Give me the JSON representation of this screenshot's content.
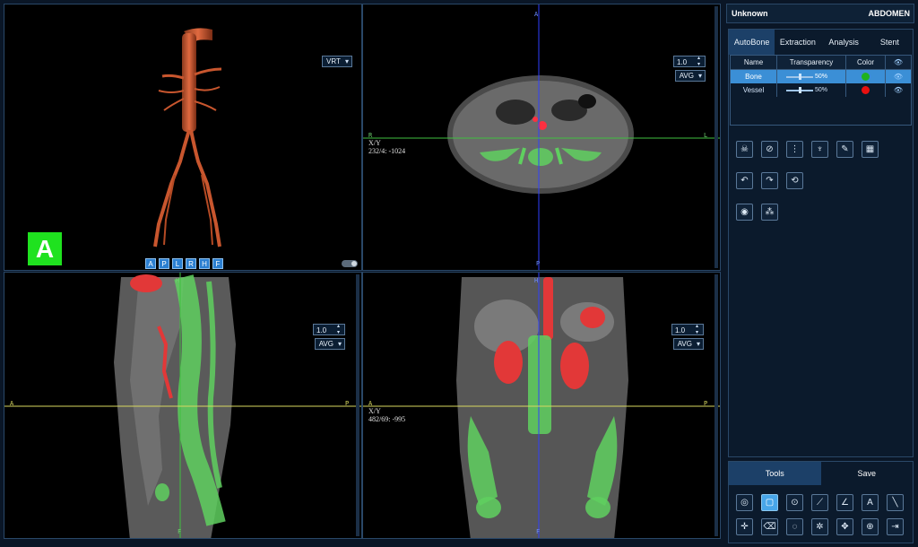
{
  "viewports": {
    "vr": {
      "mode": "VRT",
      "orientation_buttons": [
        "A",
        "P",
        "L",
        "R",
        "H",
        "F"
      ],
      "view_letter": "A"
    },
    "axial": {
      "thickness": "1.0",
      "mode": "AVG",
      "top": "A",
      "bottom": "P",
      "left": "R",
      "right": "L",
      "coord_label": "X/Y",
      "coord_value": "232/4: -1024"
    },
    "sagittal": {
      "thickness": "1.0",
      "mode": "AVG",
      "top": "H",
      "bottom": "F",
      "left": "A",
      "right": "P"
    },
    "coronal": {
      "thickness": "1.0",
      "mode": "AVG",
      "top": "H",
      "bottom": "F",
      "left": "A",
      "right": "P",
      "coord_label": "X/Y",
      "coord_value": "482/69: -995"
    }
  },
  "panel": {
    "patient": "Unknown",
    "region": "ABDOMEN",
    "tabs": [
      "AutoBone",
      "Extraction",
      "Analysis",
      "Stent"
    ],
    "table": {
      "headers": [
        "Name",
        "Transparency",
        "Color"
      ],
      "rows": [
        {
          "name": "Bone",
          "transparency": "50%",
          "value": 0.5,
          "color": "#1fb21f"
        },
        {
          "name": "Vessel",
          "transparency": "50%",
          "value": 0.5,
          "color": "#e81010"
        }
      ]
    },
    "bottom_tabs": [
      "Tools",
      "Save"
    ]
  },
  "icons": {
    "autobone": [
      "head-bone-icon",
      "skull-remove-icon",
      "spine-icon",
      "pelvis-icon",
      "vessel-pick-icon",
      "grid-mask-icon"
    ],
    "history": [
      "undo-icon",
      "redo-icon",
      "reset-view-icon"
    ],
    "misc": [
      "palette-icon",
      "cluster-icon"
    ],
    "tools_row1": [
      "eye-icon",
      "comment-icon",
      "target-icon",
      "ruler-icon",
      "angle-icon",
      "text-annotation-icon",
      "line-icon"
    ],
    "tools_row2": [
      "crosshair-icon",
      "eraser-icon",
      "circle-roi-icon",
      "settings-icon",
      "pan-icon",
      "zoom-icon",
      "exit-icon"
    ]
  }
}
